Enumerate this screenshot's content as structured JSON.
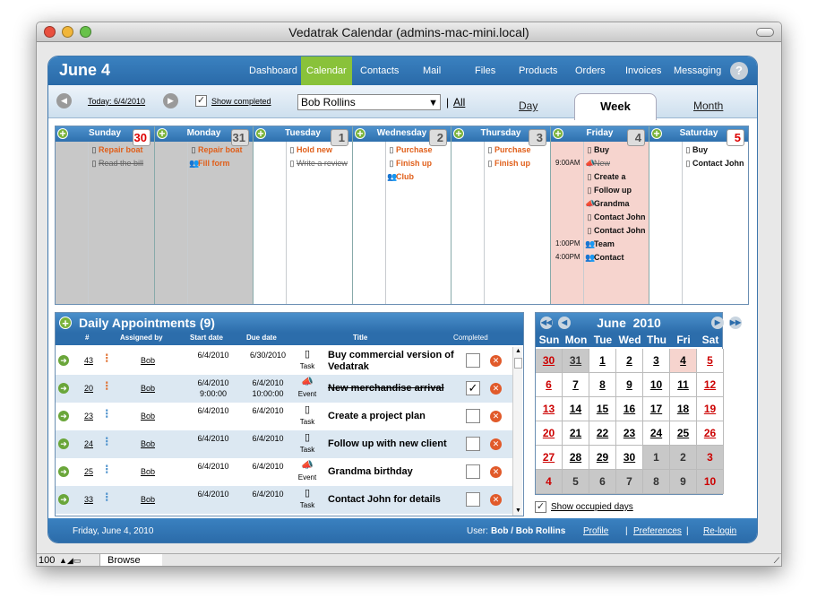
{
  "window": {
    "title": "Vedatrak Calendar (admins-mac-mini.local)"
  },
  "header": {
    "date": "June 4",
    "help": "?",
    "nav": [
      "Dashboard",
      "Calendar",
      "Contacts",
      "Mail",
      "Files",
      "Products",
      "Orders",
      "Invoices",
      "Messaging"
    ],
    "active_nav": "Calendar"
  },
  "toolbar": {
    "today": "Today: 6/4/2010",
    "show_completed": "Show completed",
    "user_select": "Bob Rollins",
    "separator": "|",
    "all": "All",
    "views": {
      "day": "Day",
      "week": "Week",
      "month": "Month"
    }
  },
  "week": {
    "days": [
      {
        "name": "Sunday",
        "num": "30",
        "red_num": true,
        "bg": "#c8c8c8",
        "events": [
          {
            "icon": "clipboard",
            "text": "Repair boat",
            "style": "o"
          },
          {
            "icon": "clipboard",
            "text": "Read the bill",
            "style": "s"
          }
        ]
      },
      {
        "name": "Monday",
        "num": "31",
        "red_num": false,
        "bg": "#c8c8c8",
        "events": [
          {
            "icon": "clipboard",
            "text": "Repair boat",
            "style": "o"
          },
          {
            "icon": "people",
            "text": "Fill form",
            "style": "o"
          }
        ]
      },
      {
        "name": "Tuesday",
        "num": "1",
        "red_num": false,
        "bg": "#ffffff",
        "events": [
          {
            "icon": "clipboard",
            "text": "Hold new",
            "style": "o"
          },
          {
            "icon": "clipboard",
            "text": "Write a review",
            "style": "s"
          }
        ]
      },
      {
        "name": "Wednesday",
        "num": "2",
        "red_num": false,
        "bg": "#ffffff",
        "events": [
          {
            "icon": "clipboard",
            "text": "Purchase",
            "style": "o"
          },
          {
            "icon": "clipboard",
            "text": "Finish up",
            "style": "o"
          },
          {
            "icon": "people",
            "text": "Club",
            "style": "o"
          }
        ]
      },
      {
        "name": "Thursday",
        "num": "3",
        "red_num": false,
        "bg": "#ffffff",
        "events": [
          {
            "icon": "clipboard",
            "text": "Purchase",
            "style": "o"
          },
          {
            "icon": "clipboard",
            "text": "Finish up",
            "style": "o"
          }
        ]
      },
      {
        "name": "Friday",
        "num": "4",
        "red_num": false,
        "bg": "#f6d4ce",
        "events": [
          {
            "icon": "clipboard",
            "text": "Buy",
            "style": "b",
            "time": ""
          },
          {
            "icon": "megaphone",
            "text": "New",
            "style": "s",
            "time": "9:00AM"
          },
          {
            "icon": "clipboard",
            "text": "Create a",
            "style": "b",
            "time": ""
          },
          {
            "icon": "clipboard",
            "text": "Follow up",
            "style": "b",
            "time": ""
          },
          {
            "icon": "megaphone",
            "text": "Grandma",
            "style": "b",
            "time": ""
          },
          {
            "icon": "clipboard",
            "text": "Contact John",
            "style": "b",
            "time": ""
          },
          {
            "icon": "clipboard",
            "text": "Contact John",
            "style": "b",
            "time": ""
          },
          {
            "icon": "people",
            "text": "Team",
            "style": "b",
            "time": "1:00PM"
          },
          {
            "icon": "people",
            "text": "Contact",
            "style": "b",
            "time": "4:00PM"
          }
        ]
      },
      {
        "name": "Saturday",
        "num": "5",
        "red_num": true,
        "bg": "#ffffff",
        "events": [
          {
            "icon": "clipboard",
            "text": "Buy",
            "style": "b"
          },
          {
            "icon": "clipboard",
            "text": "Contact John",
            "style": "b"
          }
        ]
      }
    ]
  },
  "daily": {
    "title": "Daily Appointments (9)",
    "columns": {
      "num": "#",
      "assigned": "Assigned by",
      "start": "Start date",
      "due": "Due date",
      "title": "Title",
      "completed": "Completed"
    },
    "rows": [
      {
        "num": "43",
        "pri_color": "#e07030",
        "assigned": "Bob",
        "start": "6/4/2010",
        "start2": "",
        "due": "6/30/2010",
        "due2": "",
        "type": "Task",
        "title": "Buy commercial version of Vedatrak",
        "completed": false,
        "strike": false
      },
      {
        "num": "20",
        "pri_color": "#e07030",
        "assigned": "Bob",
        "start": "6/4/2010",
        "start2": "9:00:00",
        "due": "6/4/2010",
        "due2": "10:00:00",
        "type": "Event",
        "title": "New merchandise arrival",
        "completed": true,
        "strike": true
      },
      {
        "num": "23",
        "pri_color": "#4a8fcb",
        "assigned": "Bob",
        "start": "6/4/2010",
        "start2": "",
        "due": "6/4/2010",
        "due2": "",
        "type": "Task",
        "title": "Create a project plan",
        "completed": false,
        "strike": false
      },
      {
        "num": "24",
        "pri_color": "#4a8fcb",
        "assigned": "Bob",
        "start": "6/4/2010",
        "start2": "",
        "due": "6/4/2010",
        "due2": "",
        "type": "Task",
        "title": "Follow up with new client",
        "completed": false,
        "strike": false
      },
      {
        "num": "25",
        "pri_color": "#4a8fcb",
        "assigned": "Bob",
        "start": "6/4/2010",
        "start2": "",
        "due": "6/4/2010",
        "due2": "",
        "type": "Event",
        "title": "Grandma birthday",
        "completed": false,
        "strike": false
      },
      {
        "num": "33",
        "pri_color": "#4a8fcb",
        "assigned": "Bob",
        "start": "6/4/2010",
        "start2": "",
        "due": "6/4/2010",
        "due2": "",
        "type": "Task",
        "title": "Contact John for details",
        "completed": false,
        "strike": false
      }
    ]
  },
  "mini": {
    "title": "June  2010",
    "daynames": [
      "Sun",
      "Mon",
      "Tue",
      "Wed",
      "Thu",
      "Fri",
      "Sat"
    ],
    "weeks": [
      [
        {
          "d": "30",
          "red": true,
          "grey": true
        },
        {
          "d": "31",
          "grey": true
        },
        {
          "d": "1"
        },
        {
          "d": "2"
        },
        {
          "d": "3"
        },
        {
          "d": "4",
          "today": true
        },
        {
          "d": "5",
          "red": true
        }
      ],
      [
        {
          "d": "6",
          "red": true
        },
        {
          "d": "7"
        },
        {
          "d": "8"
        },
        {
          "d": "9"
        },
        {
          "d": "10"
        },
        {
          "d": "11"
        },
        {
          "d": "12",
          "red": true
        }
      ],
      [
        {
          "d": "13",
          "red": true
        },
        {
          "d": "14"
        },
        {
          "d": "15"
        },
        {
          "d": "16"
        },
        {
          "d": "17"
        },
        {
          "d": "18"
        },
        {
          "d": "19",
          "red": true
        }
      ],
      [
        {
          "d": "20",
          "red": true
        },
        {
          "d": "21"
        },
        {
          "d": "22"
        },
        {
          "d": "23"
        },
        {
          "d": "24"
        },
        {
          "d": "25"
        },
        {
          "d": "26",
          "red": true
        }
      ],
      [
        {
          "d": "27",
          "red": true
        },
        {
          "d": "28"
        },
        {
          "d": "29"
        },
        {
          "d": "30"
        },
        {
          "d": "1",
          "grey": true,
          "plain": true
        },
        {
          "d": "2",
          "grey": true,
          "plain": true
        },
        {
          "d": "3",
          "grey": true,
          "plain": true,
          "red": true
        }
      ],
      [
        {
          "d": "4",
          "grey": true,
          "plain": true,
          "red": true
        },
        {
          "d": "5",
          "grey": true,
          "plain": true
        },
        {
          "d": "6",
          "grey": true,
          "plain": true
        },
        {
          "d": "7",
          "grey": true,
          "plain": true
        },
        {
          "d": "8",
          "grey": true,
          "plain": true
        },
        {
          "d": "9",
          "grey": true,
          "plain": true
        },
        {
          "d": "10",
          "grey": true,
          "plain": true,
          "red": true
        }
      ]
    ],
    "show_occupied": "Show occupied days"
  },
  "footer": {
    "date": "Friday, June 4, 2010",
    "user_label": "User:",
    "user": "Bob / Bob Rollins",
    "profile": "Profile",
    "preferences": "Preferences",
    "relogin": "Re-login"
  },
  "statusbar": {
    "zoom": "100",
    "mode": "Browse"
  }
}
